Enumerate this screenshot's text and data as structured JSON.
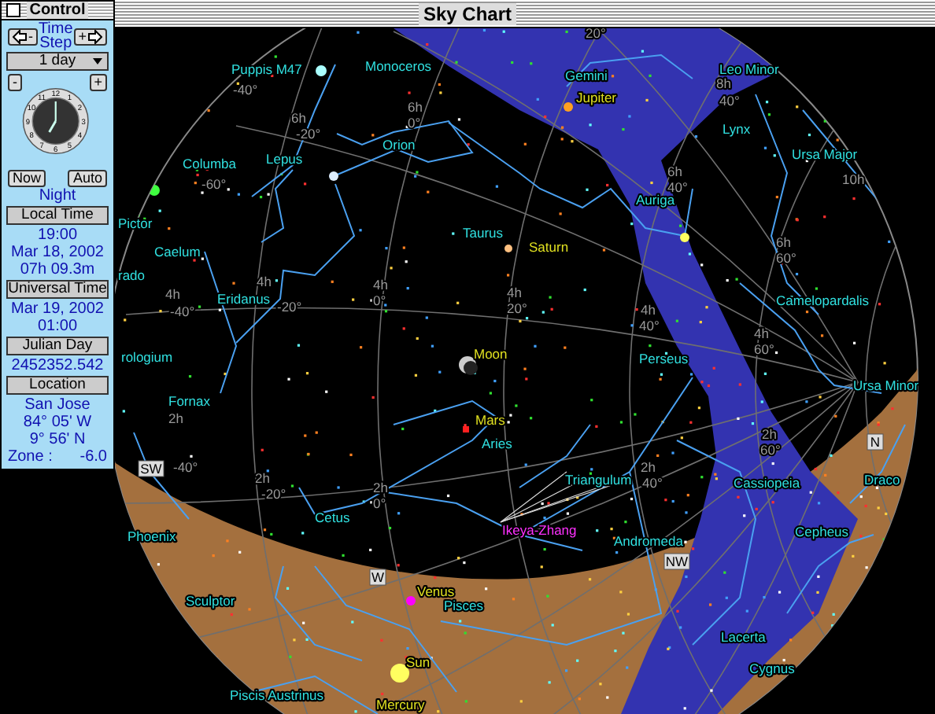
{
  "control": {
    "title": "Control",
    "time_step_label": "Time Step",
    "step_back": "-",
    "step_forward": "+",
    "step_value": "1 day",
    "clock_minus": "-",
    "clock_plus": "+",
    "dial_numbers": [
      "12",
      "1",
      "2",
      "3",
      "4",
      "5",
      "6",
      "7",
      "8",
      "9",
      "10",
      "11"
    ],
    "now_button": "Now",
    "auto_button": "Auto",
    "mode": "Night",
    "sections": [
      {
        "header": "Local Time",
        "lines": [
          "19:00",
          "Mar 18, 2002",
          "07h 09.3m"
        ]
      },
      {
        "header": "Universal Time",
        "lines": [
          "Mar 19, 2002",
          "01:00"
        ]
      },
      {
        "header": "Julian Day",
        "lines": [
          "2452352.542"
        ]
      },
      {
        "header": "Location",
        "lines": [
          "San Jose",
          "84° 05' W",
          "9° 56' N"
        ]
      }
    ],
    "zone_label": "Zone :",
    "zone_value": "-6.0"
  },
  "chart": {
    "title": "Sky Chart",
    "constellations": [
      "Puppis M47",
      "Monoceros",
      "Gemini",
      "Leo Minor",
      "Lynx",
      "Ursa Major",
      "Orion",
      "Columba",
      "Lepus",
      "Pictor",
      "Caelum",
      "rado",
      "rologium",
      "Eridanus",
      "Taurus",
      "Auriga",
      "Camelopardalis",
      "Perseus",
      "Ursa Minor",
      "Fornax",
      "Aries",
      "Triangulum",
      "Cassiopeia",
      "Draco",
      "Cepheus",
      "Andromeda",
      "Cetus",
      "Phoenix",
      "Sculptor",
      "Pisces",
      "Piscis Austrinus",
      "Lacerta",
      "Cygnus"
    ],
    "planets": [
      "Jupiter",
      "Saturn",
      "Moon",
      "Mars",
      "Venus",
      "Sun",
      "Mercury"
    ],
    "comets": [
      "Ikeya-Zhang"
    ],
    "grid_labels": [
      "20°",
      "6h",
      "0°",
      "6h",
      "-20°",
      "-40°",
      "-60°",
      "8h",
      "40°",
      "6h",
      "40°",
      "6h",
      "60°",
      "10h",
      "4h",
      "0°",
      "4h",
      "-20°",
      "4h",
      "20°",
      "4h",
      "-40°",
      "4h",
      "40°",
      "4h",
      "60°",
      "2h",
      "-40°",
      "2h",
      "-20°",
      "2h",
      "0°",
      "2h",
      "60°",
      "2h",
      "40°"
    ],
    "horizon_marks": [
      "SW",
      "W",
      "NW",
      "N"
    ]
  }
}
